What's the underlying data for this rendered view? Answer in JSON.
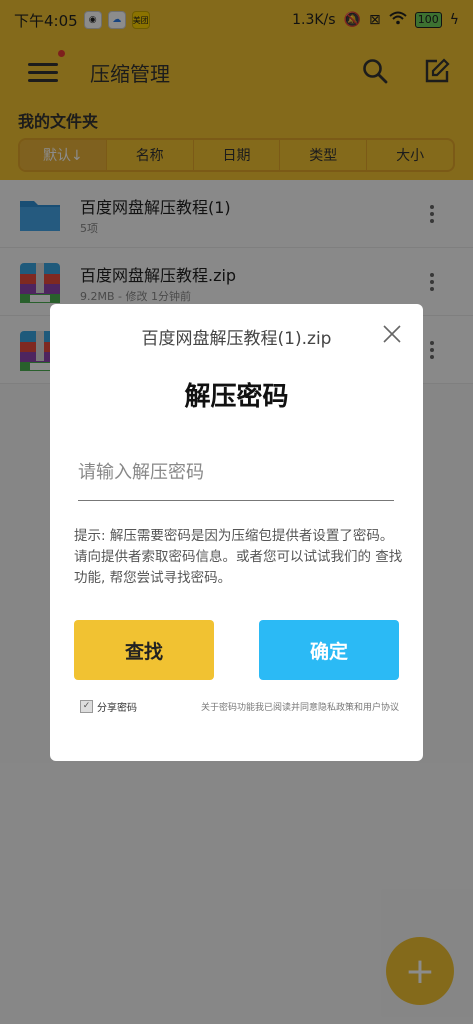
{
  "status_bar": {
    "time": "下午4:05",
    "app_badge": "美团",
    "network_speed": "1.3K/s",
    "battery": "100"
  },
  "header": {
    "title": "压缩管理"
  },
  "folder": {
    "title": "我的文件夹"
  },
  "sort_tabs": [
    {
      "label": "默认↓",
      "active": true
    },
    {
      "label": "名称",
      "active": false
    },
    {
      "label": "日期",
      "active": false
    },
    {
      "label": "类型",
      "active": false
    },
    {
      "label": "大小",
      "active": false
    }
  ],
  "files": [
    {
      "name": "百度网盘解压教程(1)",
      "meta": "5项",
      "icon": "folder-icon"
    },
    {
      "name": "百度网盘解压教程.zip",
      "meta": "9.2MB - 修改 1分钟前",
      "icon": "zip-file-icon"
    },
    {
      "name": "",
      "meta": "",
      "icon": "zip-file-icon"
    }
  ],
  "dialog": {
    "file_name": "百度网盘解压教程(1).zip",
    "title": "解压密码",
    "input_placeholder": "请输入解压密码",
    "hint": "提示: 解压需要密码是因为压缩包提供者设置了密码。请向提供者索取密码信息。或者您可以试试我们的 查找 功能, 帮您尝试寻找密码。",
    "find_button": "查找",
    "ok_button": "确定",
    "share_label": "分享密码",
    "share_checked": true,
    "policy_text": "关于密码功能我已阅读并同意隐私政策和用户协议"
  },
  "fab": {
    "label": "+"
  },
  "colors": {
    "accent_yellow": "#f1c232",
    "confirm_blue": "#2bbaf5"
  }
}
